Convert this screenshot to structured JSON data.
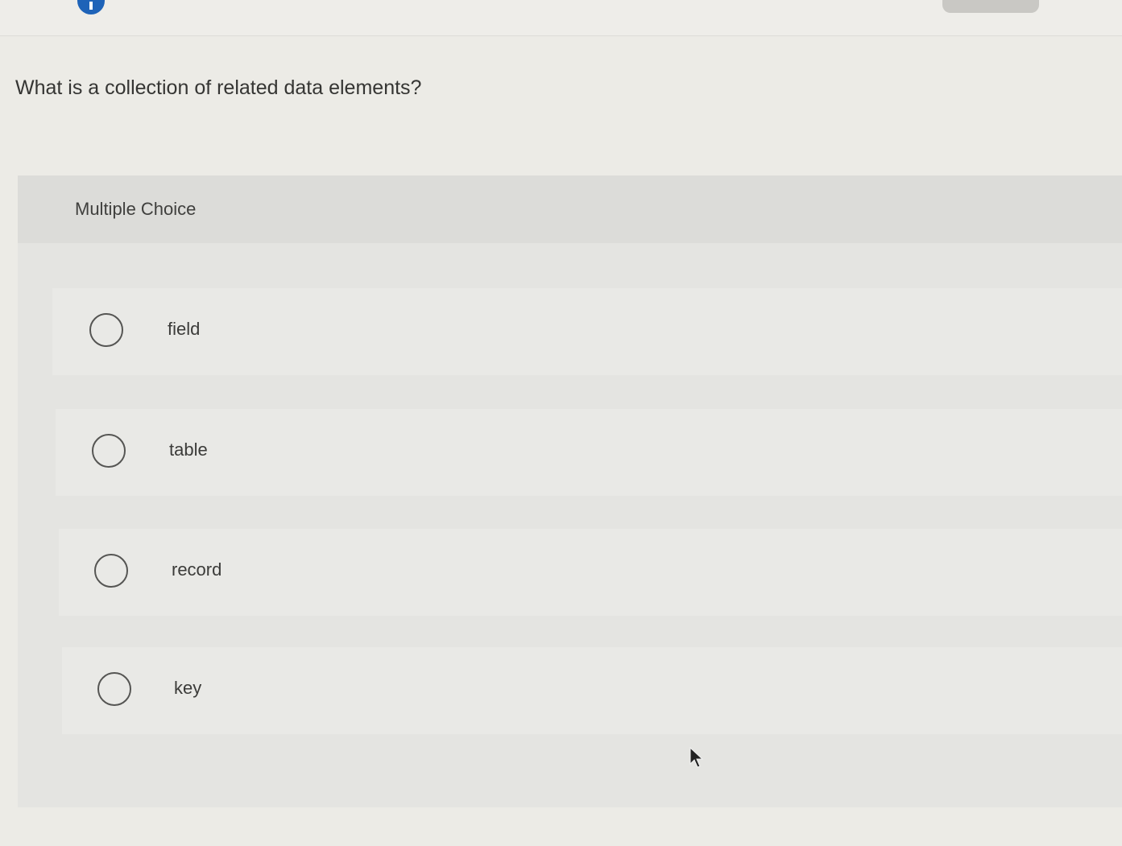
{
  "question": {
    "text": "What is a collection of related data elements?"
  },
  "panel": {
    "type_label": "Multiple Choice"
  },
  "options": [
    {
      "label": "field",
      "selected": false
    },
    {
      "label": "table",
      "selected": false
    },
    {
      "label": "record",
      "selected": false
    },
    {
      "label": "key",
      "selected": false
    }
  ],
  "icons": {
    "info": "info-icon",
    "cursor": "mouse-pointer-icon"
  },
  "colors": {
    "accent": "#1e63b8",
    "background": "#ecebe6",
    "panel": "#e1e1de"
  }
}
